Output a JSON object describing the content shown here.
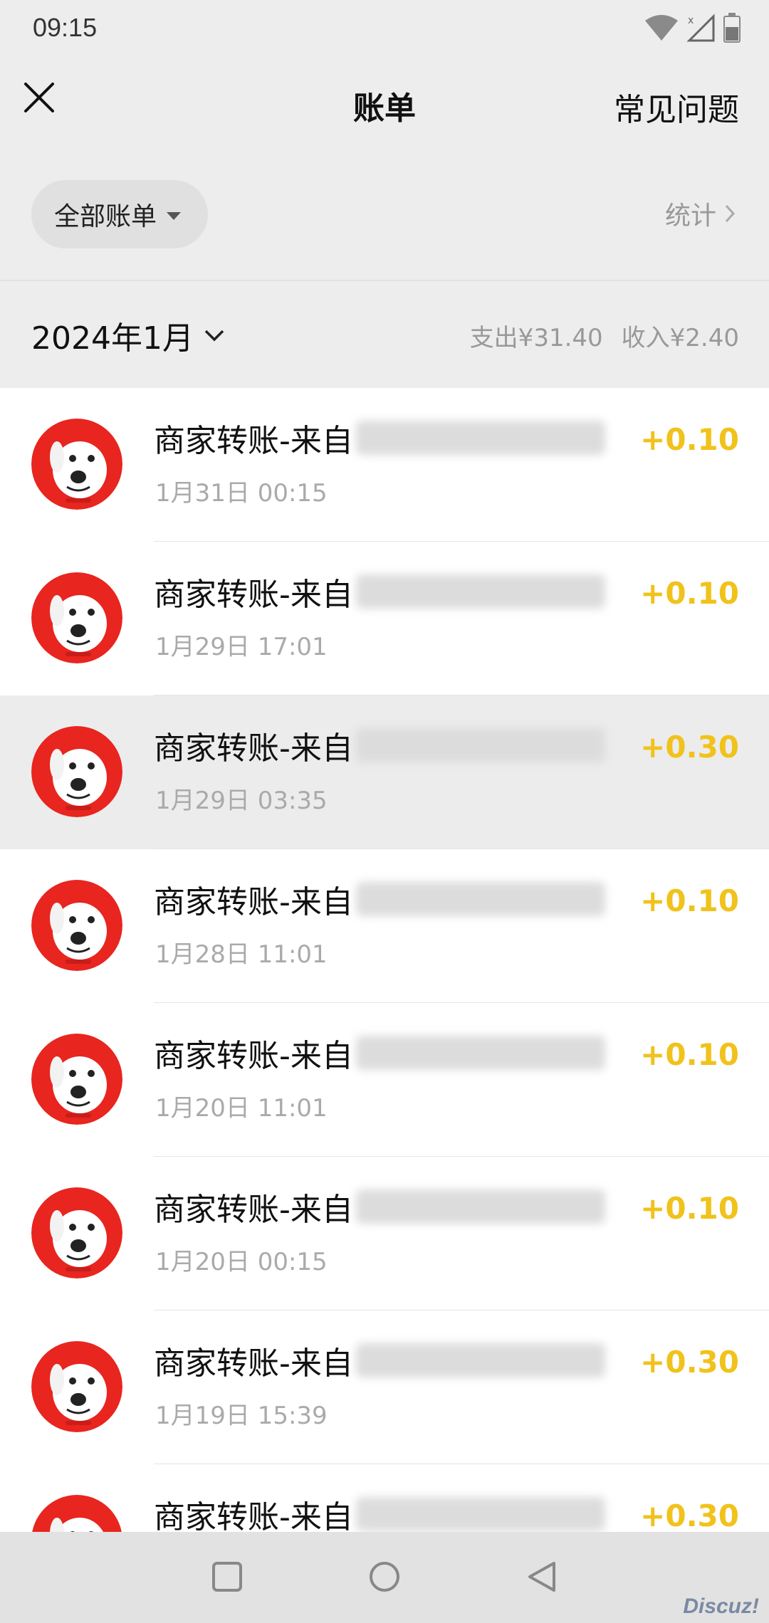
{
  "status_bar": {
    "time": "09:15"
  },
  "header": {
    "title": "账单",
    "faq_label": "常见问题"
  },
  "filter": {
    "label": "全部账单",
    "stats_label": "统计"
  },
  "month": {
    "label": "2024年1月",
    "expense": "支出¥31.40",
    "income": "收入¥2.40"
  },
  "transactions": [
    {
      "title": "商家转账-来自",
      "date": "1月31日 00:15",
      "amount": "+0.10"
    },
    {
      "title": "商家转账-来自",
      "date": "1月29日 17:01",
      "amount": "+0.10"
    },
    {
      "title": "商家转账-来自",
      "date": "1月29日 03:35",
      "amount": "+0.30"
    },
    {
      "title": "商家转账-来自",
      "date": "1月28日 11:01",
      "amount": "+0.10"
    },
    {
      "title": "商家转账-来自",
      "date": "1月20日 11:01",
      "amount": "+0.10"
    },
    {
      "title": "商家转账-来自",
      "date": "1月20日 00:15",
      "amount": "+0.10"
    },
    {
      "title": "商家转账-来自",
      "date": "1月19日 15:39",
      "amount": "+0.30"
    },
    {
      "title": "商家转账-来自",
      "date": "",
      "amount": "+0.30"
    }
  ],
  "watermark": "Discuz!",
  "colors": {
    "amount": "#f1c21b",
    "avatar_bg": "#e8251f",
    "page_bg": "#ededed"
  },
  "icons": {
    "close": "close-icon",
    "caret": "caret-down-icon",
    "chevron": "chevron-right-icon",
    "avatar": "mascot-dog-icon"
  }
}
